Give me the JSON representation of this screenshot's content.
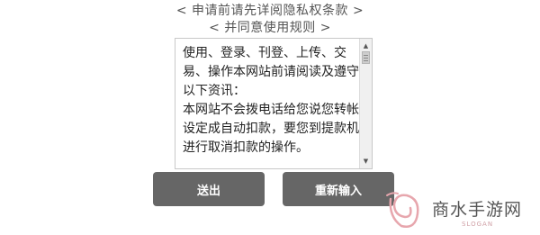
{
  "header": {
    "line1": "< 申请前请先详阅隐私权条款 >",
    "line2": "< 并同意使用规则 >"
  },
  "terms": {
    "paragraph1": "使用、登录、刊登、上传、交易、操作本网站前请阅读及遵守以下资讯：",
    "paragraph2": "本网站不会拨电话给您说您转帐设定成自动扣款，要您到提款机进行取消扣款的操作。"
  },
  "buttons": {
    "submit": "送出",
    "reset": "重新输入"
  },
  "watermark": {
    "name": "商水手游网",
    "sub": "SLOGAN"
  },
  "icons": {
    "scroll_up": "scroll-up-arrow-icon",
    "scroll_down": "scroll-down-arrow-icon",
    "logo": "watermark-logo-icon"
  },
  "colors": {
    "button_bg": "#666666",
    "watermark_pink": "#e7a6ad"
  }
}
